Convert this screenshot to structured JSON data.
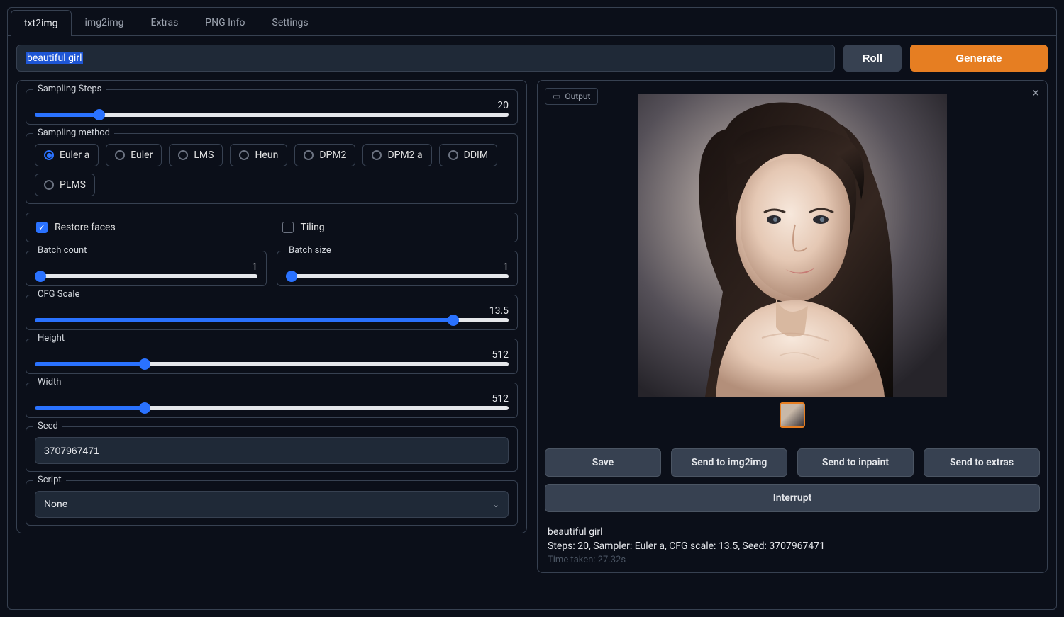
{
  "tabs": [
    "txt2img",
    "img2img",
    "Extras",
    "PNG Info",
    "Settings"
  ],
  "active_tab": "txt2img",
  "prompt": "beautiful girl",
  "buttons": {
    "roll": "Roll",
    "generate": "Generate"
  },
  "sampling_steps": {
    "label": "Sampling Steps",
    "value": 20,
    "min": 1,
    "max": 150
  },
  "sampling_method": {
    "label": "Sampling method",
    "options": [
      "Euler a",
      "Euler",
      "LMS",
      "Heun",
      "DPM2",
      "DPM2 a",
      "DDIM",
      "PLMS"
    ],
    "selected": "Euler a"
  },
  "restore_faces": {
    "label": "Restore faces",
    "checked": true
  },
  "tiling": {
    "label": "Tiling",
    "checked": false
  },
  "batch_count": {
    "label": "Batch count",
    "value": 1,
    "min": 1,
    "max": 16
  },
  "batch_size": {
    "label": "Batch size",
    "value": 1,
    "min": 1,
    "max": 8
  },
  "cfg_scale": {
    "label": "CFG Scale",
    "value": 13.5,
    "min": 1,
    "max": 15
  },
  "height": {
    "label": "Height",
    "value": 512,
    "min": 64,
    "max": 2048
  },
  "width": {
    "label": "Width",
    "value": 512,
    "min": 64,
    "max": 2048
  },
  "seed": {
    "label": "Seed",
    "value": "3707967471"
  },
  "script": {
    "label": "Script",
    "value": "None"
  },
  "output": {
    "label": "Output",
    "save": "Save",
    "send_img2img": "Send to img2img",
    "send_inpaint": "Send to inpaint",
    "send_extras": "Send to extras",
    "interrupt": "Interrupt"
  },
  "meta": {
    "prompt_line": "beautiful girl",
    "params_line": "Steps: 20, Sampler: Euler a, CFG scale: 13.5, Seed: 3707967471",
    "time_line": "Time taken: 27.32s"
  }
}
